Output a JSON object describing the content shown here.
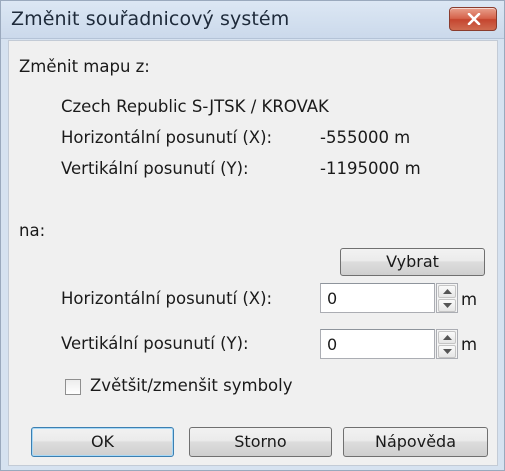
{
  "window": {
    "title": "Změnit souřadnicový systém"
  },
  "from_section": {
    "heading": "Změnit mapu z:",
    "map_name": "Czech Republic  S-JTSK / KROVAK",
    "horizontal_label": "Horizontální posunutí (X):",
    "horizontal_value": "-555000 m",
    "vertical_label": "Vertikální posunutí (Y):",
    "vertical_value": "-1195000 m"
  },
  "to_section": {
    "heading": "na:",
    "select_button": "Vybrat",
    "horizontal_label": "Horizontální posunutí (X):",
    "horizontal_input": "0",
    "horizontal_unit": "m",
    "vertical_label": "Vertikální posunutí (Y):",
    "vertical_input": "0",
    "vertical_unit": "m",
    "scale_symbols_label": "Zvětšit/zmenšit symboly",
    "scale_symbols_checked": false
  },
  "footer": {
    "ok": "OK",
    "cancel": "Storno",
    "help": "Nápověda"
  }
}
